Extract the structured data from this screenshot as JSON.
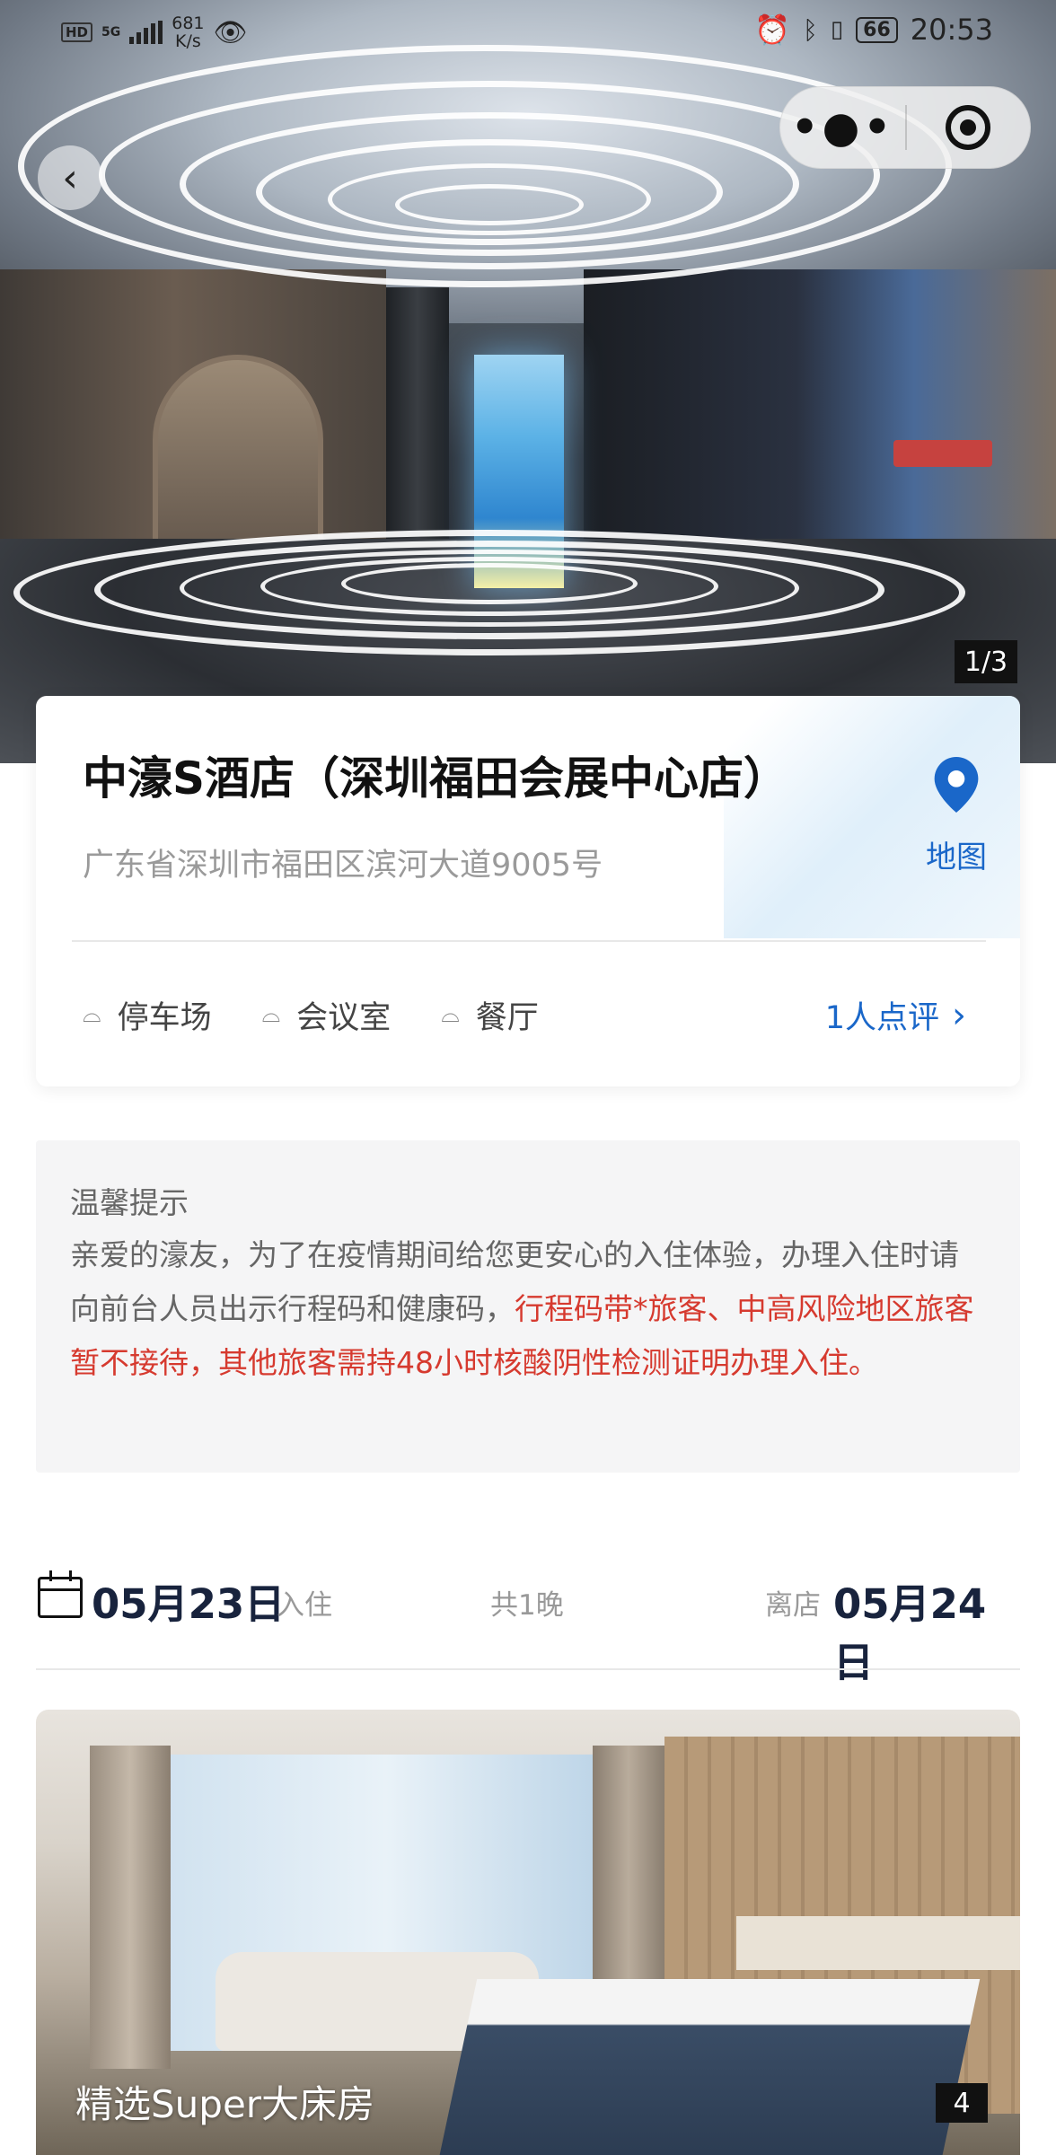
{
  "status_bar": {
    "network_badge": "HD",
    "network_type": "5G",
    "speed_value": "681",
    "speed_unit": "K/s",
    "battery": "66",
    "time": "20:53"
  },
  "gallery": {
    "pager": "1/3"
  },
  "hotel": {
    "name": "中濠S酒店（深圳福田会展中心店）",
    "address": "广东省深圳市福田区滨河大道9005号",
    "map_label": "地图",
    "facilities": [
      {
        "label": "停车场",
        "icon": "parking-icon"
      },
      {
        "label": "会议室",
        "icon": "meeting-room-icon"
      },
      {
        "label": "餐厅",
        "icon": "restaurant-icon"
      }
    ],
    "reviews_label": "1人点评"
  },
  "notice": {
    "title": "温馨提示",
    "body_normal": "亲爱的濠友，为了在疫情期间给您更安心的入住体验，办理入住时请向前台人员出示行程码和健康码，",
    "body_warning": "行程码带*旅客、中高风险地区旅客暂不接待，其他旅客需持48小时核酸阴性检测证明办理入住。"
  },
  "stay": {
    "checkin_date": "05月23日",
    "checkin_label": "入住",
    "nights": "共1晚",
    "checkout_label": "离店",
    "checkout_date": "05月24日"
  },
  "room": {
    "name": "精选Super大床房",
    "photo_count": "4"
  },
  "colors": {
    "accent_blue": "#1a67c9",
    "warning_red": "#d63a2f",
    "date_navy": "#18233d",
    "notice_bg": "#f5f5f6"
  }
}
